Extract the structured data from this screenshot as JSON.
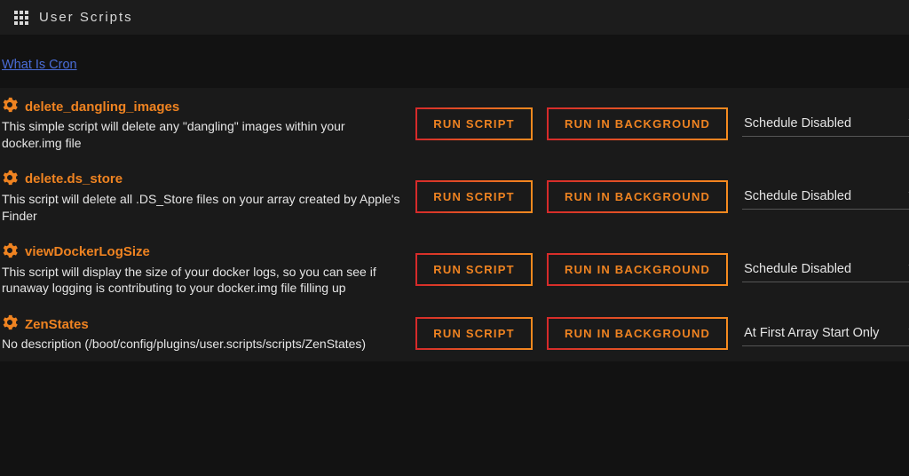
{
  "header": {
    "title": "User Scripts"
  },
  "help_link": {
    "label": "What Is Cron"
  },
  "buttons": {
    "run": "RUN SCRIPT",
    "run_bg": "RUN IN BACKGROUND"
  },
  "schedule_options": [
    "Schedule Disabled",
    "At First Array Start Only"
  ],
  "scripts": [
    {
      "name": "delete_dangling_images",
      "description": "This simple script will delete any \"dangling\" images within your docker.img file",
      "schedule": "Schedule Disabled"
    },
    {
      "name": "delete.ds_store",
      "description": "This script will delete all .DS_Store files on your array created by Apple's Finder",
      "schedule": "Schedule Disabled"
    },
    {
      "name": "viewDockerLogSize",
      "description": "This script will display the size of your docker logs, so you can see if runaway logging is contributing to your docker.img file filling up",
      "schedule": "Schedule Disabled"
    },
    {
      "name": "ZenStates",
      "description": "No description (/boot/config/plugins/user.scripts/scripts/ZenStates)",
      "schedule": "At First Array Start Only"
    }
  ]
}
